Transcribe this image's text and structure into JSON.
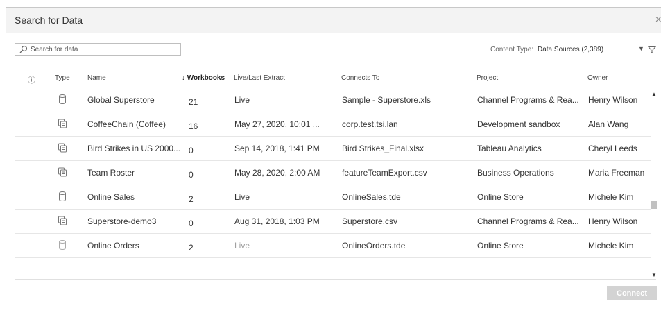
{
  "dialog": {
    "title": "Search for Data",
    "close_glyph": "×"
  },
  "search": {
    "placeholder": "Search for data",
    "icon": "search-icon"
  },
  "content_type": {
    "label": "Content Type:",
    "value": "Data Sources (2,389)",
    "caret": "▼",
    "filter_icon": "filter-icon"
  },
  "columns": {
    "info": "ⓘ",
    "type": "Type",
    "name": "Name",
    "workbooks": "↓ Workbooks",
    "live": "Live/Last Extract",
    "connects": "Connects To",
    "project": "Project",
    "owner": "Owner"
  },
  "rows": [
    {
      "type_icon": "cylinder-icon",
      "name": "Global Superstore",
      "workbooks": "21",
      "live": "Live",
      "connects": "Sample - Superstore.xls",
      "project": "Channel Programs & Rea...",
      "owner": "Henry Wilson"
    },
    {
      "type_icon": "extract-icon",
      "name": "CoffeeChain (Coffee)",
      "workbooks": "16",
      "live": "May 27, 2020, 10:01 ...",
      "connects": "corp.test.tsi.lan",
      "project": "Development sandbox",
      "owner": "Alan  Wang"
    },
    {
      "type_icon": "extract-icon",
      "name": "Bird Strikes in US 2000...",
      "workbooks": "0",
      "live": "Sep 14, 2018, 1:41 PM",
      "connects": "Bird Strikes_Final.xlsx",
      "project": "Tableau Analytics",
      "owner": "Cheryl Leeds"
    },
    {
      "type_icon": "extract-icon",
      "name": "Team Roster",
      "workbooks": "0",
      "live": "May 28, 2020, 2:00 AM",
      "connects": "featureTeamExport.csv",
      "project": "Business Operations",
      "owner": "Maria Freeman"
    },
    {
      "type_icon": "cylinder-icon",
      "name": "Online Sales",
      "workbooks": "2",
      "live": "Live",
      "connects": "OnlineSales.tde",
      "project": "Online Store",
      "owner": "Michele Kim"
    },
    {
      "type_icon": "extract-icon",
      "name": "Superstore-demo3",
      "workbooks": "0",
      "live": "Aug 31, 2018, 1:03 PM",
      "connects": "Superstore.csv",
      "project": "Channel Programs & Rea...",
      "owner": "Henry Wilson"
    },
    {
      "type_icon": "cylinder-icon",
      "name": "Online Orders",
      "workbooks": "2",
      "live": "Live",
      "connects": "OnlineOrders.tde",
      "project": "Online Store",
      "owner": "Michele Kim"
    }
  ],
  "scrollbar": {
    "up": "▲",
    "down": "▼"
  },
  "connect_button": {
    "label": "Connect"
  }
}
